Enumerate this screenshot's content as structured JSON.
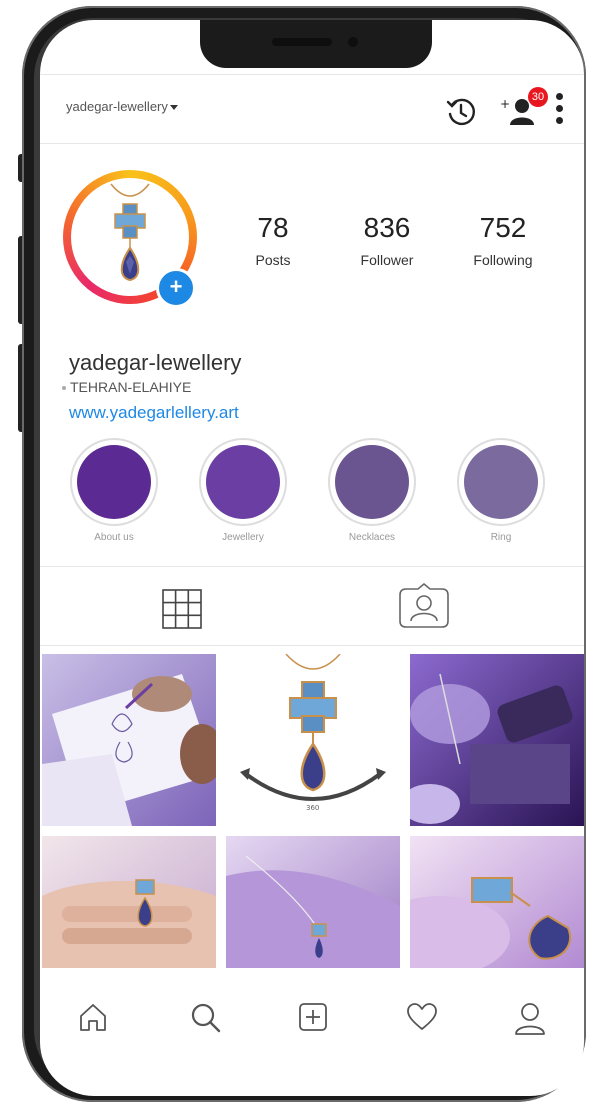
{
  "header": {
    "username": "yadegar-lewellery",
    "notification_count": "30"
  },
  "profile": {
    "stats": [
      {
        "value": "78",
        "label": "Posts"
      },
      {
        "value": "836",
        "label": "Follower"
      },
      {
        "value": "752",
        "label": "Following"
      }
    ],
    "name": "yadegar-lewellery",
    "location": "TEHRAN-ELAHIYE",
    "website": "www.yadegarlellery.art"
  },
  "highlights": [
    {
      "label": "About us",
      "color": "#5b2a92"
    },
    {
      "label": "Jewellery",
      "color": "#6a3ea3"
    },
    {
      "label": "Necklaces",
      "color": "#6a5590"
    },
    {
      "label": "Ring",
      "color": "#7a6a9e"
    }
  ],
  "tabs": [
    {
      "icon": "grid-icon"
    },
    {
      "icon": "tagged-user-icon"
    }
  ],
  "posts": [
    {
      "subject": "jewellery sketch drawing",
      "label": ""
    },
    {
      "subject": "pendant 360 view",
      "label": "360"
    },
    {
      "subject": "jeweller at workbench",
      "label": ""
    },
    {
      "subject": "hand with ring",
      "label": ""
    },
    {
      "subject": "necklace on purple",
      "label": ""
    },
    {
      "subject": "pendant close-up",
      "label": ""
    }
  ],
  "navbar": [
    {
      "icon": "home-icon"
    },
    {
      "icon": "search-icon"
    },
    {
      "icon": "add-post-icon"
    },
    {
      "icon": "heart-icon"
    },
    {
      "icon": "profile-icon"
    }
  ],
  "colors": {
    "accent": "#1e88e5",
    "badge": "#e8171f",
    "ring_start": "#f9c21a",
    "ring_end": "#e9296a"
  }
}
